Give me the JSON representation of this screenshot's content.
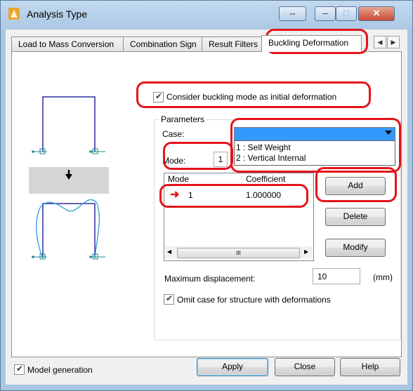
{
  "window": {
    "title": "Analysis Type",
    "buttons": {
      "restore": "⇔",
      "minimize": "–",
      "maximize": "□",
      "close": "✕"
    }
  },
  "tabs": [
    {
      "label": "Load to Mass Conversion"
    },
    {
      "label": "Combination Sign"
    },
    {
      "label": "Result Filters"
    },
    {
      "label": "Buckling Deformation"
    }
  ],
  "options": {
    "consider_buckling": {
      "label": "Consider buckling mode as initial deformation",
      "checked": true
    }
  },
  "parameters": {
    "group_label": "Parameters",
    "case_label": "Case:",
    "case_value": "",
    "case_options": [
      "1 : Self Weight",
      "2 : Vertical Internal"
    ],
    "mode_label": "Mode:",
    "mode_value": "1",
    "list": {
      "columns": [
        "Mode",
        "Coefficient"
      ],
      "rows": [
        {
          "mode": "1",
          "coefficient": "1.000000"
        }
      ],
      "scroll_glyph": "III"
    },
    "buttons": {
      "add": "Add",
      "delete": "Delete",
      "modify": "Modify"
    },
    "max_displacement": {
      "label": "Maximum displacement:",
      "value": "10",
      "unit": "(mm)"
    },
    "omit_case": {
      "label": "Omit case for structure with deformations",
      "checked": true
    }
  },
  "footer": {
    "model_generation": {
      "label": "Model generation",
      "checked": true
    },
    "apply": "Apply",
    "close": "Close",
    "help": "Help"
  },
  "colors": {
    "highlight": "#e4141b",
    "selection": "#3399ff",
    "frame_blue": "#2b2b9e",
    "deformed": "#2c9ed6"
  }
}
